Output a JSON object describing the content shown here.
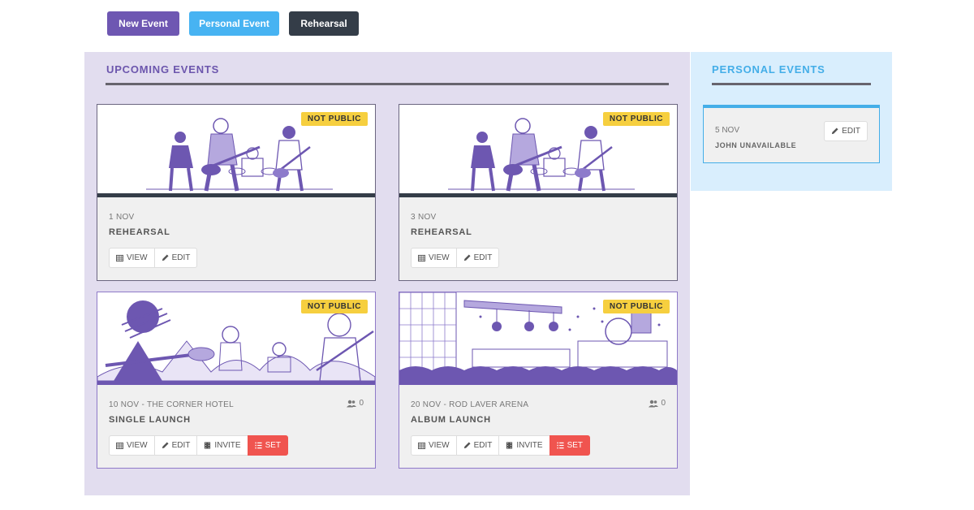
{
  "toolbar": {
    "new_event_label": "New Event",
    "personal_event_label": "Personal Event",
    "rehearsal_label": "Rehearsal"
  },
  "upcoming": {
    "title": "UPCOMING EVENTS",
    "events": [
      {
        "badge": "NOT PUBLIC",
        "date": "1 NOV",
        "name": "REHEARSAL",
        "view": "VIEW",
        "edit": "EDIT"
      },
      {
        "badge": "NOT PUBLIC",
        "date": "3 NOV",
        "name": "REHEARSAL",
        "view": "VIEW",
        "edit": "EDIT"
      },
      {
        "badge": "NOT PUBLIC",
        "date": "10 NOV - THE CORNER HOTEL",
        "name": "SINGLE LAUNCH",
        "attendees": "0",
        "view": "VIEW",
        "edit": "EDIT",
        "invite": "INVITE",
        "set": "SET"
      },
      {
        "badge": "NOT PUBLIC",
        "date": "20 NOV - ROD LAVER ARENA",
        "name": "ALBUM LAUNCH",
        "attendees": "0",
        "view": "VIEW",
        "edit": "EDIT",
        "invite": "INVITE",
        "set": "SET"
      }
    ]
  },
  "personal": {
    "title": "PERSONAL EVENTS",
    "events": [
      {
        "date": "5 NOV",
        "name": "JOHN UNAVAILABLE",
        "edit": "EDIT"
      }
    ]
  },
  "colors": {
    "purple": "#6e57b2",
    "blue": "#47b3f2",
    "dark": "#343d48",
    "badge": "#f6cf3f",
    "set": "#f0544f"
  }
}
